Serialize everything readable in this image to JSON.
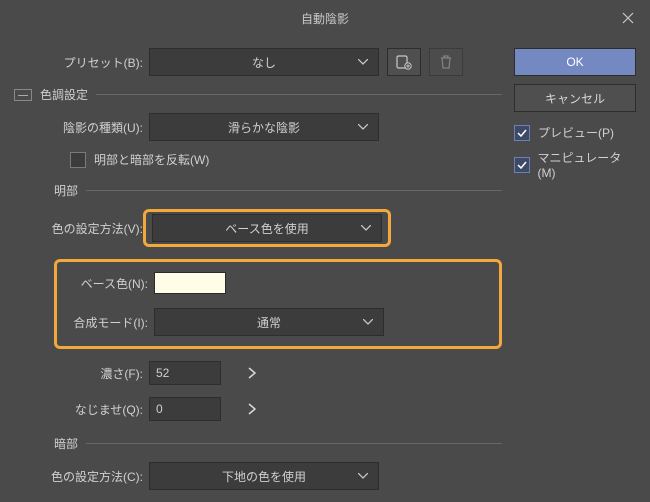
{
  "title": "自動陰影",
  "preset": {
    "label": "プリセット(B):",
    "value": "なし"
  },
  "buttons": {
    "ok": "OK",
    "cancel": "キャンセル"
  },
  "checks": {
    "preview": "プレビュー(P)",
    "manipulator": "マニピュレータ(M)"
  },
  "toneGroup": "色調設定",
  "shadowType": {
    "label": "陰影の種類(U):",
    "value": "滑らかな陰影"
  },
  "invert": {
    "label": "明部と暗部を反転(W)"
  },
  "light": {
    "group": "明部",
    "colorMethod": {
      "label": "色の設定方法(V):",
      "value": "ベース色を使用"
    },
    "baseColor": {
      "label": "ベース色(N):"
    },
    "blendMode": {
      "label": "合成モード(I):",
      "value": "通常"
    },
    "intensity": {
      "label": "濃さ(F):",
      "value": "52"
    },
    "blur": {
      "label": "なじませ(Q):",
      "value": "0"
    }
  },
  "dark": {
    "group": "暗部",
    "colorMethod": {
      "label": "色の設定方法(C):",
      "value": "下地の色を使用"
    }
  }
}
